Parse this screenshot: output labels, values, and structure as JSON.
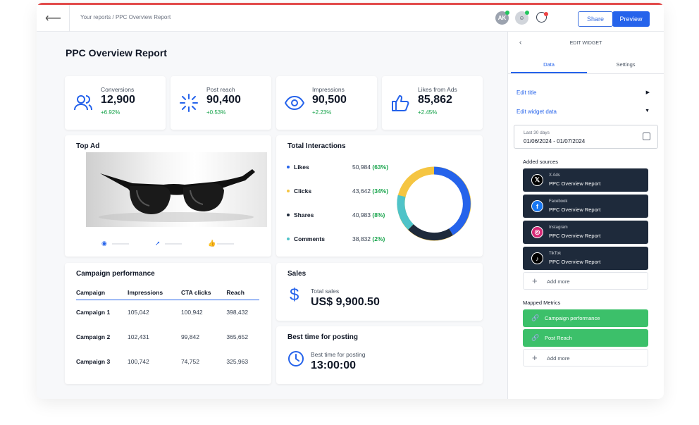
{
  "header": {
    "breadcrumb": "Your reports / PPC Overview Report",
    "avatar_initials": "AK",
    "share_label": "Share",
    "preview_label": "Preview"
  },
  "report": {
    "title": "PPC Overview Report"
  },
  "kpis": [
    {
      "label": "Conversions",
      "value": "12,900",
      "delta": "+6.92%",
      "icon": "users-icon"
    },
    {
      "label": "Post reach",
      "value": "90,400",
      "delta": "+0.53%",
      "icon": "loader-icon"
    },
    {
      "label": "Impressions",
      "value": "90,500",
      "delta": "+2.23%",
      "icon": "eye-icon"
    },
    {
      "label": "Likes from Ads",
      "value": "85,862",
      "delta": "+2.45%",
      "icon": "thumbs-up-icon"
    }
  ],
  "top_ad": {
    "title": "Top Ad"
  },
  "interactions": {
    "title": "Total Interactions",
    "rows": [
      {
        "label": "Likes",
        "value": "50,984",
        "pct": "(63%)",
        "color": "#2563eb"
      },
      {
        "label": "Clicks",
        "value": "43,642",
        "pct": "(34%)",
        "color": "#f5c542"
      },
      {
        "label": "Shares",
        "value": "40,983",
        "pct": "(8%)",
        "color": "#1e2a3b"
      },
      {
        "label": "Comments",
        "value": "38,832",
        "pct": "(2%)",
        "color": "#4fc3c8"
      }
    ]
  },
  "campaign": {
    "title": "Campaign performance",
    "headers": [
      "Campaign",
      "Impressions",
      "CTA clicks",
      "Reach"
    ],
    "rows": [
      [
        "Campaign 1",
        "105,042",
        "100,942",
        "398,432"
      ],
      [
        "Campaign 2",
        "102,431",
        "99,842",
        "365,652"
      ],
      [
        "Campaign 3",
        "100,742",
        "74,752",
        "325,963"
      ]
    ]
  },
  "sales": {
    "title": "Sales",
    "label": "Total sales",
    "value": "US$ 9,900.50"
  },
  "posting": {
    "title": "Best time for posting",
    "label": "Best time for posting",
    "value": "13:00:00"
  },
  "panel": {
    "title": "EDIT WIDGET",
    "tab_data": "Data",
    "tab_settings": "Settings",
    "edit_title": "Edit title",
    "edit_widget_data": "Edit widget data",
    "date_label": "Last 30 days",
    "date_value": "01/06/2024 - 01/07/2024",
    "added_sources": "Added sources",
    "sources": [
      {
        "network": "X Ads",
        "report": "PPC Overview Report",
        "color": "#000000",
        "glyph": "𝕏"
      },
      {
        "network": "Facebook",
        "report": "PPC Overview Report",
        "color": "#1877f2",
        "glyph": "f"
      },
      {
        "network": "Instagram",
        "report": "PPC Overview Report",
        "color": "#d62976",
        "glyph": "◎"
      },
      {
        "network": "TikTok",
        "report": "PPC Overview Report",
        "color": "#000000",
        "glyph": "♪"
      }
    ],
    "add_more": "Add more",
    "mapped_metrics": "Mapped Metrics",
    "metrics": [
      "Campaign performance",
      "Post Reach"
    ]
  }
}
